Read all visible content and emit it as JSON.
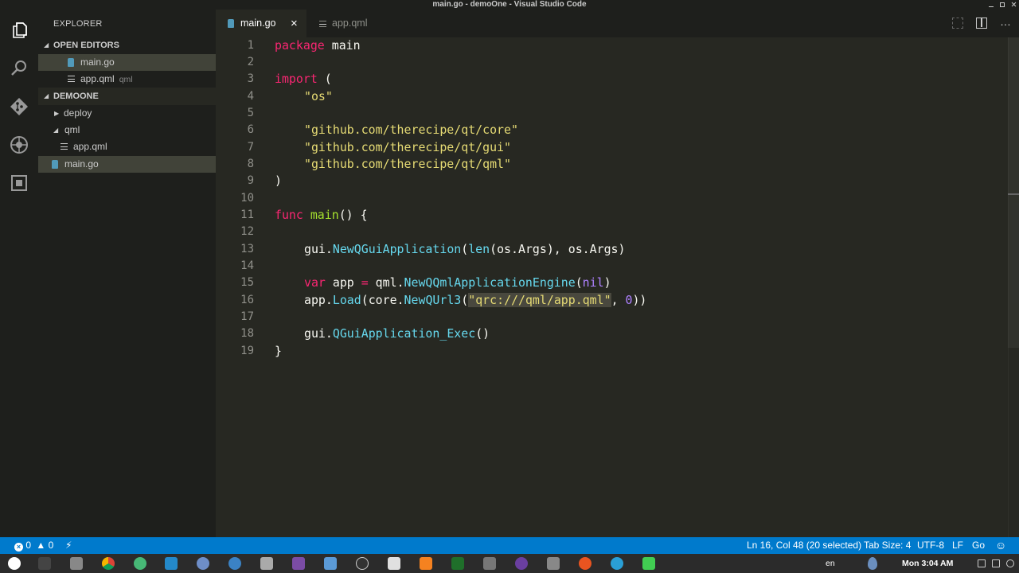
{
  "window": {
    "title": "main.go - demoOne - Visual Studio Code"
  },
  "activity_bar": {
    "items": [
      "files-icon",
      "search-icon",
      "git-icon",
      "debug-icon",
      "extensions-icon"
    ]
  },
  "sidebar": {
    "title": "EXPLORER",
    "open_editors": {
      "label": "OPEN EDITORS",
      "items": [
        {
          "name": "main.go",
          "description": ""
        },
        {
          "name": "app.qml",
          "description": "qml"
        }
      ]
    },
    "folder": {
      "label": "DEMOONE",
      "items": [
        "deploy",
        "qml",
        "app.qml",
        "main.go"
      ]
    }
  },
  "tabs": [
    {
      "label": "main.go",
      "close": "×"
    },
    {
      "label": "app.qml"
    }
  ],
  "tab_actions": {
    "more": "…"
  },
  "editor": {
    "line_numbers": [
      "1",
      "2",
      "3",
      "4",
      "5",
      "6",
      "7",
      "8",
      "9",
      "10",
      "11",
      "12",
      "13",
      "14",
      "15",
      "16",
      "17",
      "18",
      "19"
    ],
    "code": {
      "l1_kw": "package",
      "l1_rest": " main",
      "l3_kw": "import",
      "l3_rest": " (",
      "l4_str": "\"os\"",
      "l6_str": "\"github.com/therecipe/qt/core\"",
      "l7_str": "\"github.com/therecipe/qt/gui\"",
      "l8_str": "\"github.com/therecipe/qt/qml\"",
      "l9": ")",
      "l11_kw": "func",
      "l11_fn": "main",
      "l11_rest": "() {",
      "l13_a": "gui.",
      "l13_fn": "NewQGuiApplication",
      "l13_b": "(",
      "l13_len": "len",
      "l13_c": "(os.Args), os.Args)",
      "l15_kw": "var",
      "l15_a": " app ",
      "l15_eq": "=",
      "l15_b": " qml.",
      "l15_fn": "NewQQmlApplicationEngine",
      "l15_c": "(",
      "l15_nil": "nil",
      "l15_d": ")",
      "l16_a": "app.",
      "l16_fn": "Load",
      "l16_b": "(core.",
      "l16_fn2": "NewQUrl3",
      "l16_c": "(",
      "l16_str": "\"qrc:///qml/app.qml\"",
      "l16_d": ", ",
      "l16_num": "0",
      "l16_e": "))",
      "l18_a": "gui.",
      "l18_fn": "QGuiApplication_Exec",
      "l18_b": "()",
      "l19": "}"
    }
  },
  "status_bar": {
    "errors": "0",
    "warnings": "0",
    "position": "Ln 16, Col 48 (20 selected)",
    "tab_size": "Tab Size: 4",
    "encoding": "UTF-8",
    "eol": "LF",
    "language": "Go"
  },
  "taskbar": {
    "lang": "en",
    "clock": "Mon  3:04 AM"
  },
  "colors": {
    "keyword": "#f92672",
    "string": "#e6db74",
    "function": "#a6e22e",
    "builtin": "#66d9ef",
    "number": "#ae81ff",
    "status_bar": "#007acc"
  }
}
